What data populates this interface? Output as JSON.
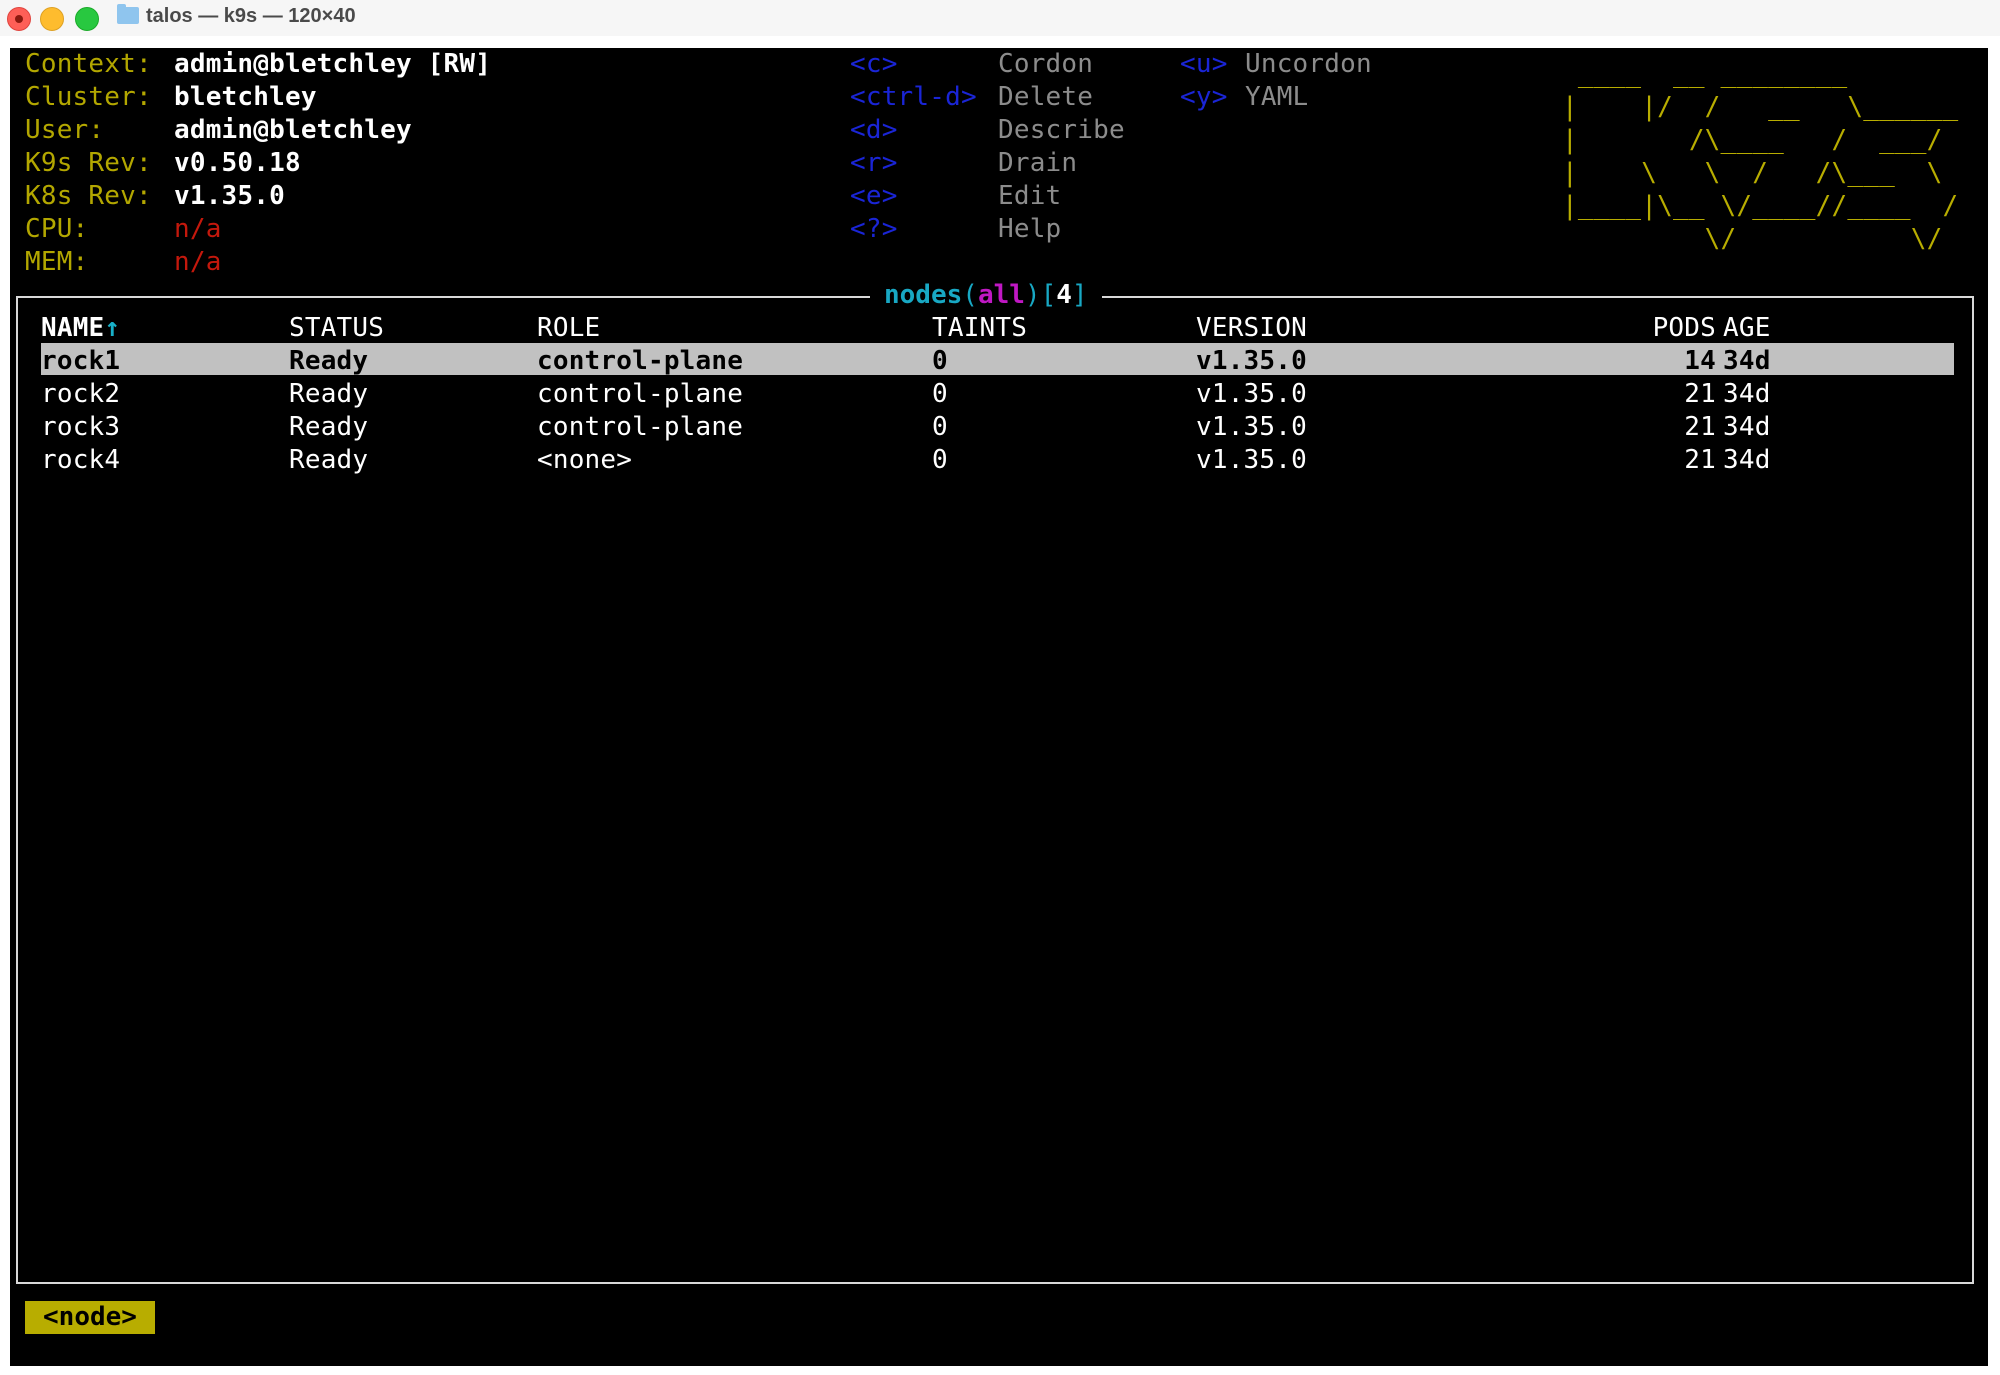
{
  "window": {
    "title": "talos — k9s — 120×40"
  },
  "header": {
    "info": [
      {
        "label": "Context:",
        "value": "admin@bletchley [RW]"
      },
      {
        "label": "Cluster:",
        "value": "bletchley"
      },
      {
        "label": "User:",
        "value": "admin@bletchley"
      },
      {
        "label": "K9s Rev:",
        "value": "v0.50.18"
      },
      {
        "label": "K8s Rev:",
        "value": "v1.35.0"
      },
      {
        "label": "CPU:",
        "value": "n/a"
      },
      {
        "label": "MEM:",
        "value": "n/a"
      }
    ],
    "shortcuts_col1": [
      {
        "key": "<c>",
        "action": "Cordon"
      },
      {
        "key": "<ctrl-d>",
        "action": "Delete"
      },
      {
        "key": "<d>",
        "action": "Describe"
      },
      {
        "key": "<r>",
        "action": "Drain"
      },
      {
        "key": "<e>",
        "action": "Edit"
      },
      {
        "key": "<?>",
        "action": "Help"
      }
    ],
    "shortcuts_col2": [
      {
        "key": "<u>",
        "action": "Uncordon"
      },
      {
        "key": "<y>",
        "action": "YAML"
      }
    ],
    "logo_lines": [
      " ____  __ ________       ",
      "|    |/  /   __   \\______",
      "|       /\\____   /  ___/",
      "|    \\   \\  /   /\\___  \\",
      "|____|\\__ \\/____//____  /",
      "         \\/           \\/ "
    ]
  },
  "table": {
    "resource": "nodes",
    "namespace": "all",
    "count": "4",
    "open_paren": "(",
    "close_paren": ")",
    "open_bracket": "[",
    "close_bracket": "]",
    "sort_indicator": "↑",
    "columns": [
      "NAME",
      "STATUS",
      "ROLE",
      "TAINTS",
      "VERSION",
      "PODS",
      "AGE"
    ],
    "rows": [
      {
        "name": "rock1",
        "status": "Ready",
        "role": "control-plane",
        "taints": "0",
        "version": "v1.35.0",
        "pods": "14",
        "age": "34d"
      },
      {
        "name": "rock2",
        "status": "Ready",
        "role": "control-plane",
        "taints": "0",
        "version": "v1.35.0",
        "pods": "21",
        "age": "34d"
      },
      {
        "name": "rock3",
        "status": "Ready",
        "role": "control-plane",
        "taints": "0",
        "version": "v1.35.0",
        "pods": "21",
        "age": "34d"
      },
      {
        "name": "rock4",
        "status": "Ready",
        "role": "<none>",
        "taints": "0",
        "version": "v1.35.0",
        "pods": "21",
        "age": "34d"
      }
    ]
  },
  "crumb": "<node>",
  "colors": {
    "label": "#b3a700",
    "key": "#1a25d6",
    "error": "#c4180c",
    "accent": "#18a8c4",
    "namespace": "#c018c4",
    "selection": "#c1c1c1"
  }
}
